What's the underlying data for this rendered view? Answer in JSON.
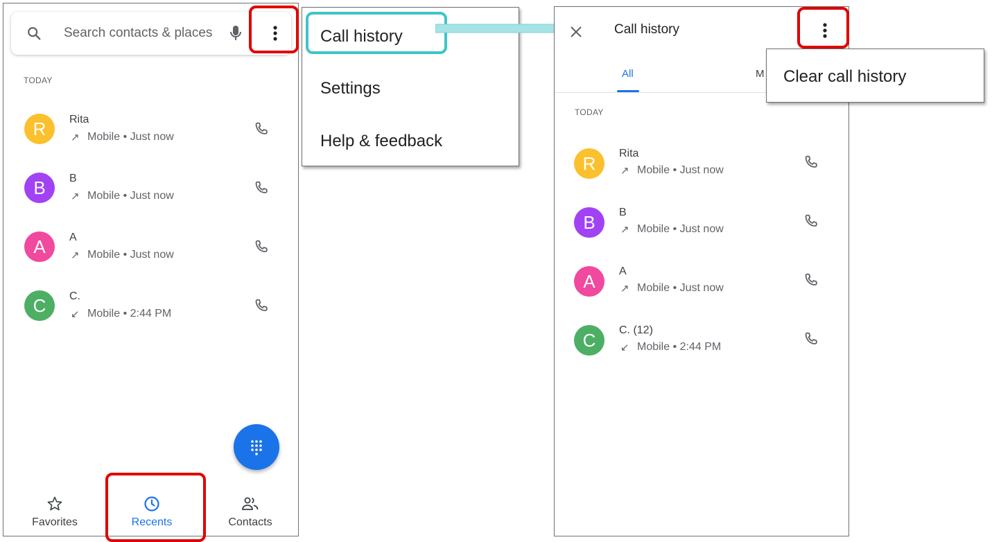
{
  "colors": {
    "accent": "#1a73e8",
    "highlight_red": "#e00000",
    "highlight_cyan": "#40c4c8",
    "avatar_yellow": "#fbc02d",
    "avatar_purple": "#a142f4",
    "avatar_pink": "#f0499e",
    "avatar_green": "#4caf63"
  },
  "left_screen": {
    "search": {
      "placeholder": "Search contacts & places",
      "icons": [
        "search-icon",
        "mic-icon",
        "more-vert-icon"
      ]
    },
    "section_today": "TODAY",
    "calls": [
      {
        "initial": "R",
        "name": "Rita",
        "direction": "↗",
        "detail": "Mobile • Just now",
        "color": "#fbc02d"
      },
      {
        "initial": "B",
        "name": "B",
        "direction": "↗",
        "detail": "Mobile • Just now",
        "color": "#a142f4"
      },
      {
        "initial": "A",
        "name": "A",
        "direction": "↗",
        "detail": "Mobile • Just now",
        "color": "#f0499e"
      },
      {
        "initial": "C",
        "name": "C.",
        "direction": "↙",
        "detail": "Mobile • 2:44 PM",
        "color": "#4caf63"
      }
    ],
    "bottom_nav": [
      {
        "label": "Favorites",
        "icon": "star-icon",
        "active": false
      },
      {
        "label": "Recents",
        "icon": "clock-icon",
        "active": true
      },
      {
        "label": "Contacts",
        "icon": "people-icon",
        "active": false
      }
    ]
  },
  "overflow_menu": {
    "items": [
      "Call history",
      "Settings",
      "Help & feedback"
    ]
  },
  "right_screen": {
    "title": "Call history",
    "tabs": [
      {
        "label": "All",
        "active": true
      },
      {
        "label": "M",
        "active": false
      }
    ],
    "section_today": "TODAY",
    "calls": [
      {
        "initial": "R",
        "name": "Rita",
        "direction": "↗",
        "detail": "Mobile • Just now",
        "color": "#fbc02d"
      },
      {
        "initial": "B",
        "name": "B",
        "direction": "↗",
        "detail": "Mobile • Just now",
        "color": "#a142f4"
      },
      {
        "initial": "A",
        "name": "A",
        "direction": "↗",
        "detail": "Mobile • Just now",
        "color": "#f0499e"
      },
      {
        "initial": "C",
        "name": "C. (12)",
        "direction": "↙",
        "detail": "Mobile • 2:44 PM",
        "color": "#4caf63"
      }
    ],
    "popup_menu": {
      "items": [
        "Clear call history"
      ]
    }
  }
}
